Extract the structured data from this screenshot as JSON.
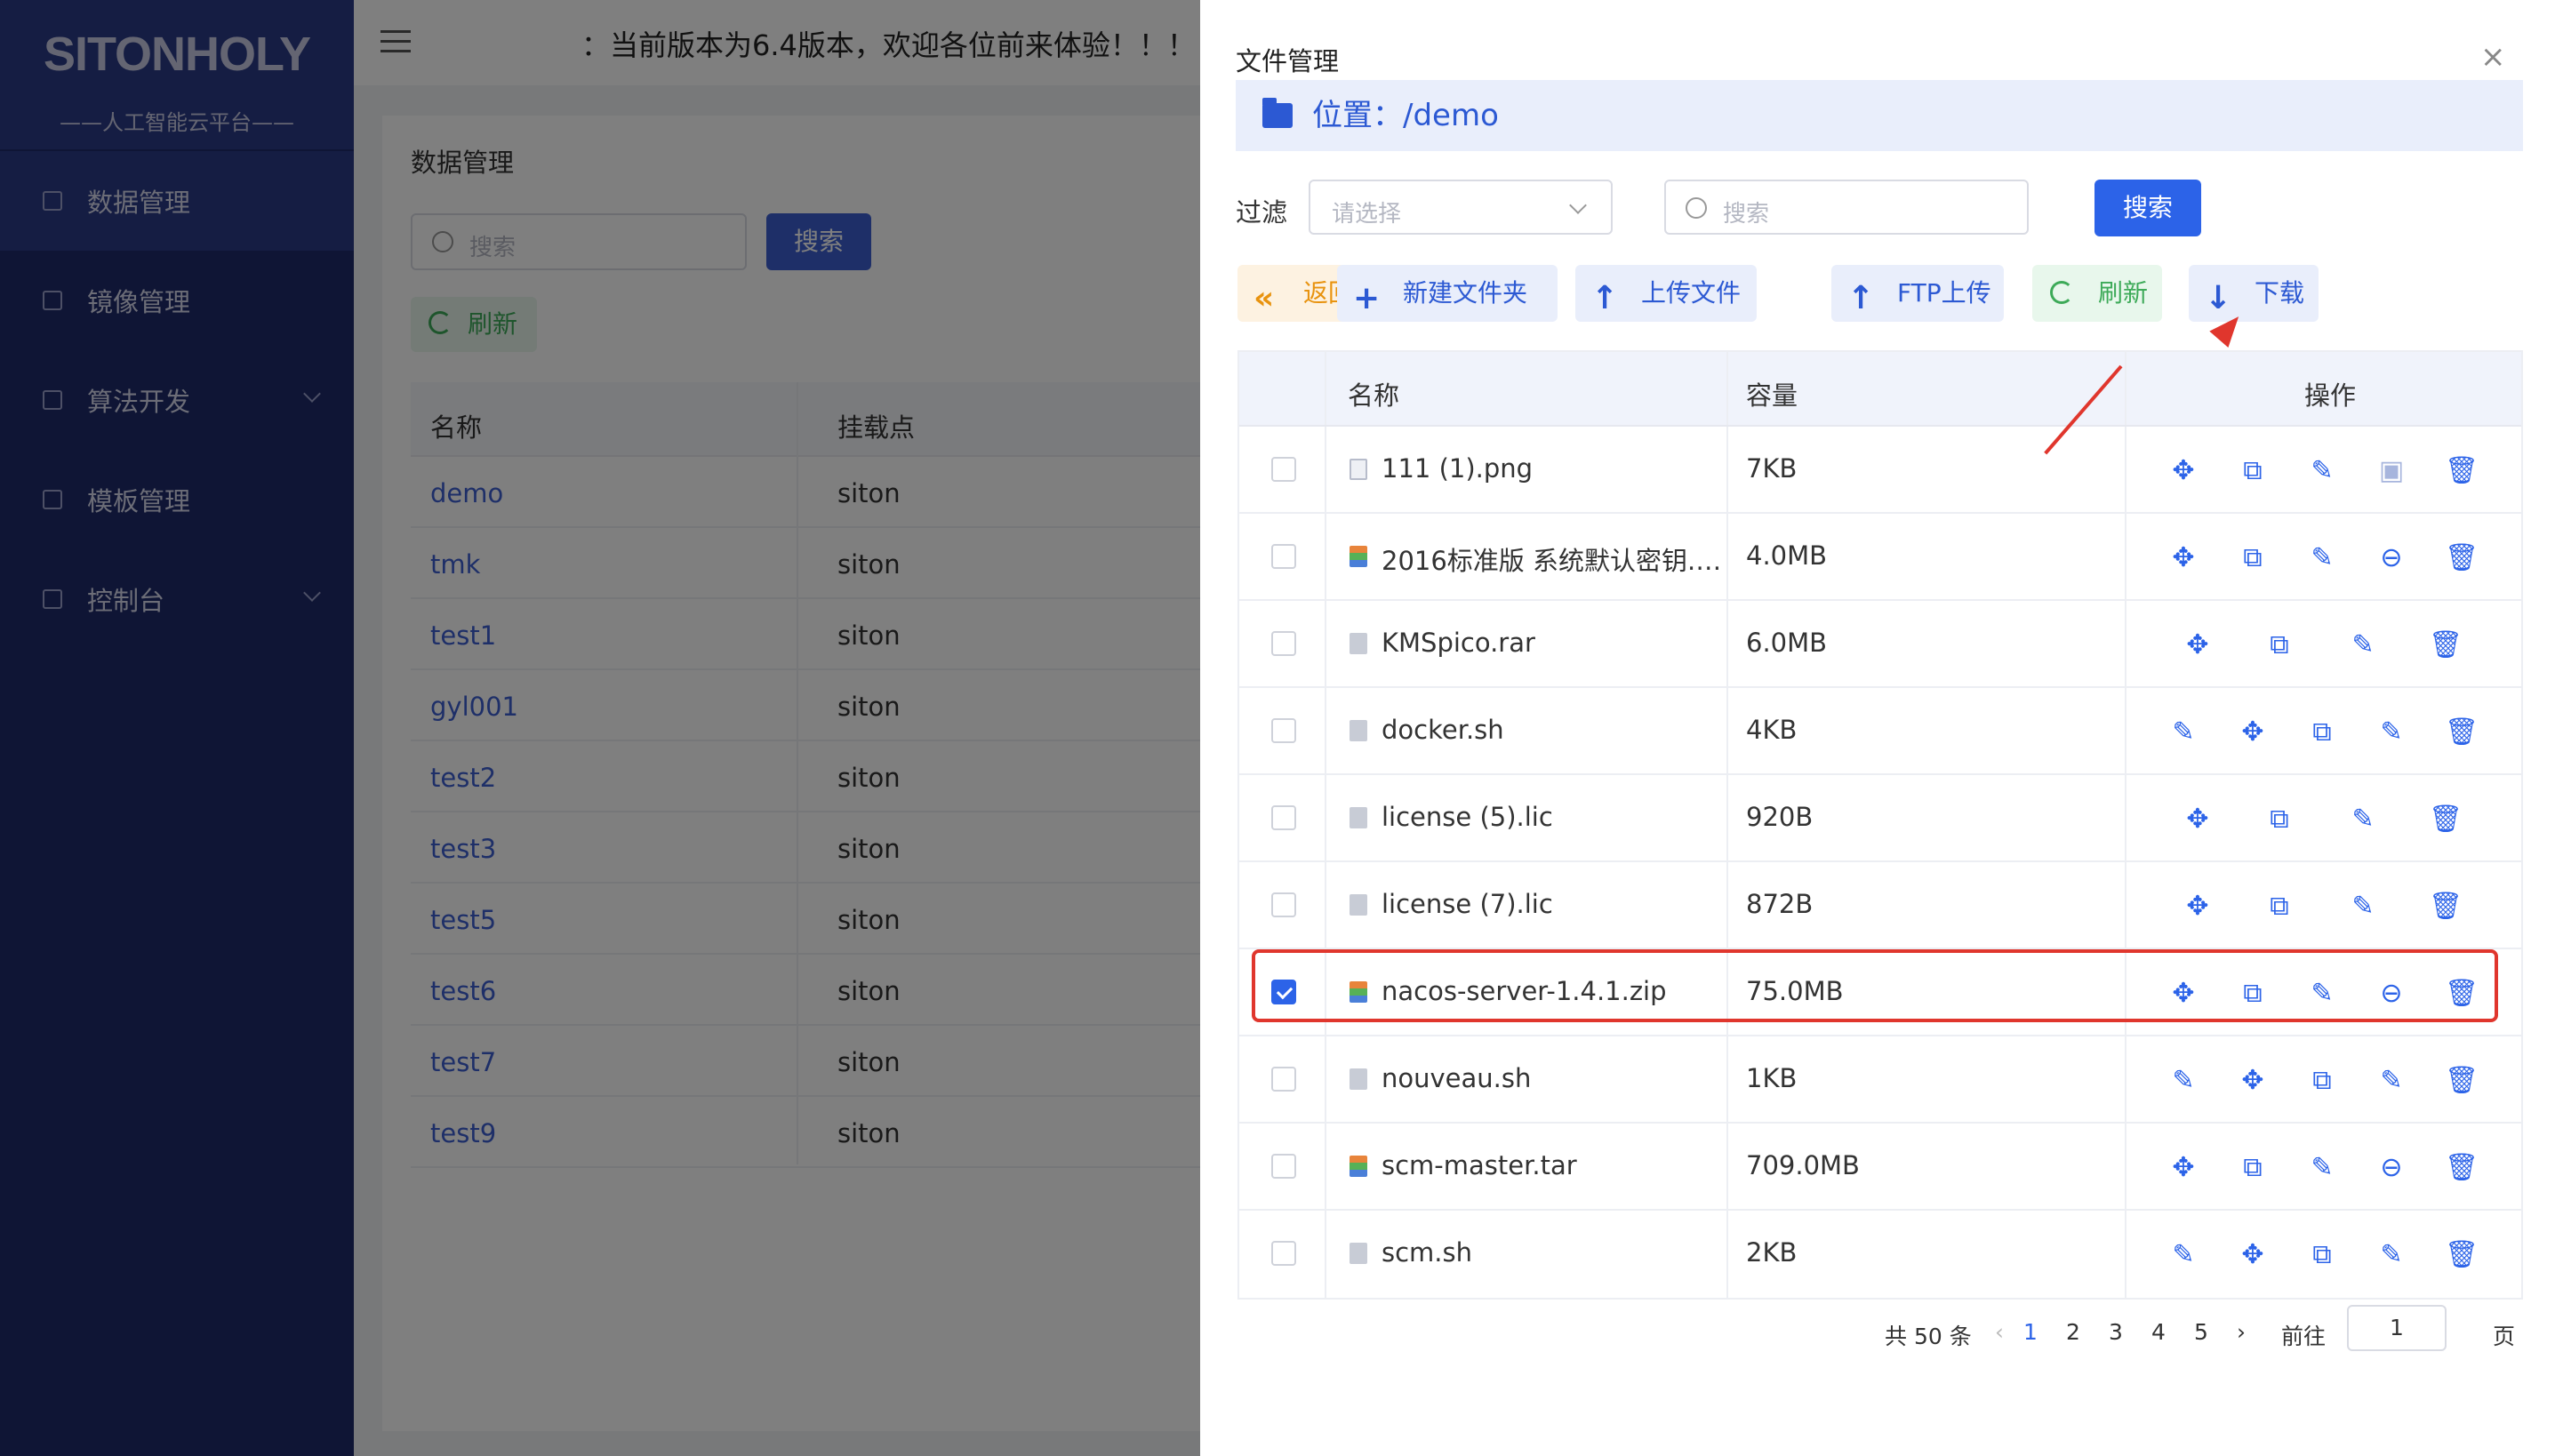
{
  "sidebar": {
    "logo": "SITONHOLY",
    "subtitle": "——人工智能云平台——",
    "items": [
      {
        "label": "数据管理"
      },
      {
        "label": "镜像管理"
      },
      {
        "label": "算法开发"
      },
      {
        "label": "模板管理"
      },
      {
        "label": "控制台"
      }
    ]
  },
  "topbar": {
    "notice": "：当前版本为6.4版本，欢迎各位前来体验！！！"
  },
  "main": {
    "title": "数据管理",
    "search_placeholder": "搜索",
    "search_button": "搜索",
    "refresh_button": "刷新",
    "columns": [
      "名称",
      "挂载点"
    ],
    "rows": [
      {
        "name": "demo",
        "mount": "siton"
      },
      {
        "name": "tmk",
        "mount": "siton"
      },
      {
        "name": "test1",
        "mount": "siton"
      },
      {
        "name": "gyl001",
        "mount": "siton"
      },
      {
        "name": "test2",
        "mount": "siton"
      },
      {
        "name": "test3",
        "mount": "siton"
      },
      {
        "name": "test5",
        "mount": "siton"
      },
      {
        "name": "test6",
        "mount": "siton"
      },
      {
        "name": "test7",
        "mount": "siton"
      },
      {
        "name": "test9",
        "mount": "siton"
      }
    ]
  },
  "drawer": {
    "title": "文件管理",
    "close": "×",
    "location": "位置：/demo",
    "filter_label": "过滤",
    "filter_placeholder": "请选择",
    "search_placeholder": "搜索",
    "search_button": "搜索",
    "toolbar": {
      "back": "返回",
      "new_folder": "新建文件夹",
      "upload": "上传文件",
      "ftp_upload": "FTP上传",
      "refresh": "刷新",
      "download": "下载"
    },
    "columns": {
      "name": "名称",
      "size": "容量",
      "actions": "操作"
    },
    "files": [
      {
        "name": "111 (1).png",
        "size": "7KB",
        "icon": "image-file-icon",
        "checked": false
      },
      {
        "name": "2016标准版 系统默认密钥.…",
        "size": "4.0MB",
        "icon": "archive-file-icon",
        "checked": false
      },
      {
        "name": "KMSpico.rar",
        "size": "6.0MB",
        "icon": "document-file-icon",
        "checked": false
      },
      {
        "name": "docker.sh",
        "size": "4KB",
        "icon": "document-file-icon",
        "checked": false
      },
      {
        "name": "license (5).lic",
        "size": "920B",
        "icon": "document-file-icon",
        "checked": false
      },
      {
        "name": "license (7).lic",
        "size": "872B",
        "icon": "document-file-icon",
        "checked": false
      },
      {
        "name": "nacos-server-1.4.1.zip",
        "size": "75.0MB",
        "icon": "archive-file-icon",
        "checked": true
      },
      {
        "name": "nouveau.sh",
        "size": "1KB",
        "icon": "document-file-icon",
        "checked": false
      },
      {
        "name": "scm-master.tar",
        "size": "709.0MB",
        "icon": "archive-file-icon",
        "checked": false
      },
      {
        "name": "scm.sh",
        "size": "2KB",
        "icon": "document-file-icon",
        "checked": false
      }
    ],
    "pagination": {
      "total": "共 50 条",
      "pages": [
        "1",
        "2",
        "3",
        "4",
        "5"
      ],
      "current": "1",
      "goto_label": "前往",
      "goto_value": "1",
      "page_suffix": "页"
    }
  },
  "colors": {
    "sidebar": "#1f2a6b",
    "primary": "#2c63e8",
    "highlight": "#e0362d",
    "back_button": "#e8930f",
    "refresh_button": "#3daa58"
  }
}
